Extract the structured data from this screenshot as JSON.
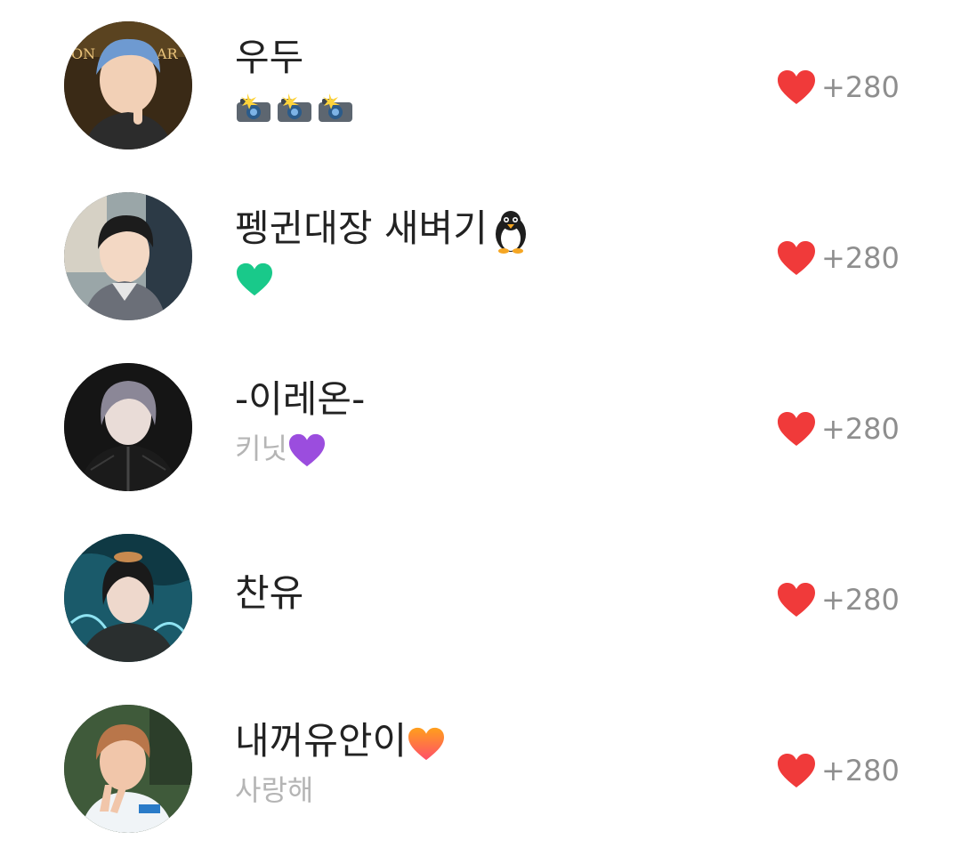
{
  "likes_list": {
    "items": [
      {
        "name": "우두",
        "status": "",
        "status_icons": [
          "camera-flash-icon",
          "camera-flash-icon",
          "camera-flash-icon"
        ],
        "likes": "+280",
        "avatar_colors": {
          "bg": "#3a2a16",
          "hair": "#6e9ad1",
          "skin": "#f2d0b6",
          "clothes": "#2c2c2c"
        }
      },
      {
        "name": "펭귄대장 새벼기",
        "name_icon": "penguin-icon",
        "status": "",
        "status_icons": [
          "green-heart-icon"
        ],
        "likes": "+280",
        "avatar_colors": {
          "bg": "#9aa6a8",
          "hair": "#1c1c1c",
          "skin": "#f3d8c4",
          "clothes": "#6b6f78"
        }
      },
      {
        "name": "-이레온-",
        "status": "키닛",
        "status_icons": [
          "purple-heart-icon"
        ],
        "likes": "+280",
        "avatar_colors": {
          "bg": "#151515",
          "hair": "#8b8797",
          "skin": "#e9dcd7",
          "clothes": "#1b1b1b"
        }
      },
      {
        "name": "찬유",
        "status": "",
        "status_icons": [],
        "likes": "+280",
        "avatar_colors": {
          "bg": "#1a5a6a",
          "hair": "#1a1a1a",
          "skin": "#eed8cc",
          "clothes": "#2a2f2f"
        }
      },
      {
        "name": "내꺼유안이",
        "name_icon": "orange-heart-icon",
        "status": "사랑해",
        "status_icons": [],
        "likes": "+280",
        "avatar_colors": {
          "bg": "#3f5a3a",
          "hair": "#b9764a",
          "skin": "#f1c6aa",
          "clothes": "#f0f4f7"
        }
      }
    ]
  },
  "colors": {
    "name_text": "#222222",
    "status_text": "#b5b5b5",
    "count_text": "#8e8e8e",
    "like_heart": "#f03a3a",
    "green_heart": "#19c98a",
    "purple_heart": "#9b4dde",
    "orange_heart": "#ff8a1c"
  }
}
